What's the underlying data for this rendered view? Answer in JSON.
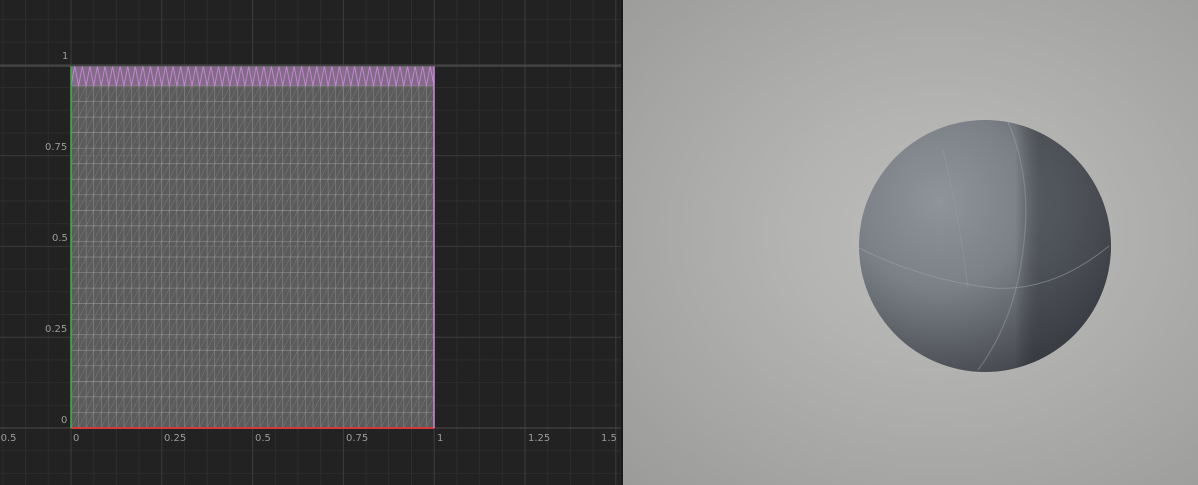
{
  "uv_editor": {
    "axis_x_ticks": [
      "-0.5",
      "0",
      "0.25",
      "0.5",
      "0.75",
      "1",
      "1.25",
      "1.5"
    ],
    "axis_y_ticks": [
      "0",
      "0.25",
      "0.5",
      "0.75",
      "1"
    ],
    "colors": {
      "background": "#222222",
      "grid_major": "#3c3c3c",
      "grid_minor": "#2d2d2d",
      "axis_u": "#d23c3c",
      "axis_v": "#3cb44b",
      "uv_fill": "#8a8a8a",
      "uv_mesh_line": "#b8b8b8",
      "uv_selected_edge": "#c98ad6",
      "tick_label": "#9a9a9a"
    }
  },
  "viewport": {
    "object_icon": "sphere-mesh",
    "colors": {
      "background": "#b3b3b1",
      "sphere_light": "#8d939a",
      "sphere_dark": "#3e4248"
    }
  }
}
